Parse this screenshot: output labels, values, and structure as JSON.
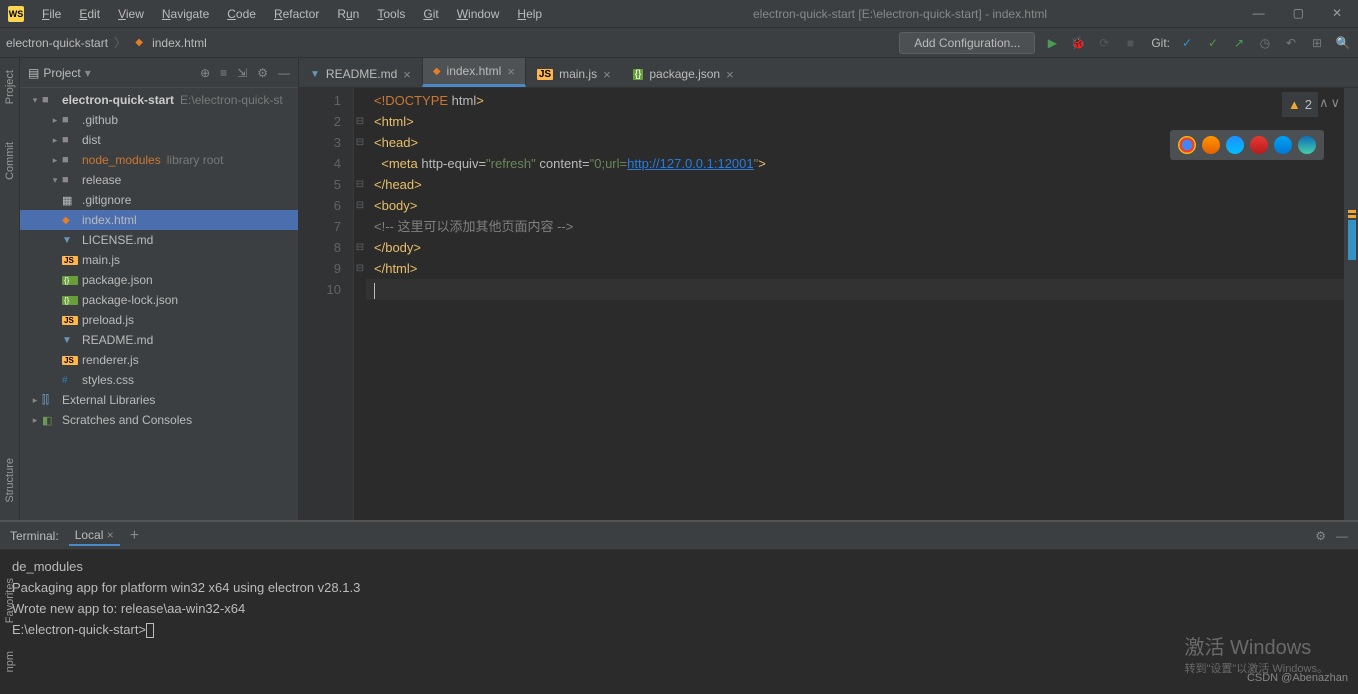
{
  "app": {
    "icon": "WS",
    "title": "electron-quick-start [E:\\electron-quick-start] - index.html"
  },
  "menu": [
    "File",
    "Edit",
    "View",
    "Navigate",
    "Code",
    "Refactor",
    "Run",
    "Tools",
    "Git",
    "Window",
    "Help"
  ],
  "breadcrumb": {
    "root": "electron-quick-start",
    "file": "index.html"
  },
  "toolbar": {
    "config": "Add Configuration...",
    "git_label": "Git:"
  },
  "project_panel": {
    "title": "Project",
    "root": {
      "name": "electron-quick-start",
      "path": "E:\\electron-quick-st"
    },
    "folders": [
      {
        "name": ".github",
        "expanded": false
      },
      {
        "name": "dist",
        "expanded": false
      },
      {
        "name": "node_modules",
        "hint": "library root",
        "expanded": false,
        "highlight": true
      },
      {
        "name": "release",
        "expanded": false
      }
    ],
    "files": [
      {
        "name": ".gitignore",
        "type": "txt"
      },
      {
        "name": "index.html",
        "type": "html",
        "selected": true
      },
      {
        "name": "LICENSE.md",
        "type": "md"
      },
      {
        "name": "main.js",
        "type": "js"
      },
      {
        "name": "package.json",
        "type": "json"
      },
      {
        "name": "package-lock.json",
        "type": "json"
      },
      {
        "name": "preload.js",
        "type": "js"
      },
      {
        "name": "README.md",
        "type": "md"
      },
      {
        "name": "renderer.js",
        "type": "js"
      },
      {
        "name": "styles.css",
        "type": "css"
      }
    ],
    "extra": [
      "External Libraries",
      "Scratches and Consoles"
    ]
  },
  "tabs": [
    {
      "label": "README.md",
      "type": "md"
    },
    {
      "label": "index.html",
      "type": "html",
      "active": true
    },
    {
      "label": "main.js",
      "type": "js"
    },
    {
      "label": "package.json",
      "type": "json"
    }
  ],
  "code": {
    "lines": [
      "1",
      "2",
      "3",
      "4",
      "5",
      "6",
      "7",
      "8",
      "9",
      "10"
    ],
    "l1_doctype": "<!DOCTYPE",
    "l1_html": " html",
    "l4_meta": "meta",
    "l4_attr1": "http-equiv=",
    "l4_val1": "\"refresh\"",
    "l4_attr2": "content=",
    "l4_val2a": "\"0;url=",
    "l4_link": "http://127.0.0.1:12001",
    "l4_val2b": "\"",
    "l7_comment": "<!-- 这里可以添加其他页面内容 -->"
  },
  "warnings": {
    "count": "2"
  },
  "terminal": {
    "label": "Terminal:",
    "tab": "Local",
    "lines": [
      "de_modules",
      "",
      "Packaging app for platform win32 x64 using electron v28.1.3",
      "Wrote new app to: release\\aa-win32-x64",
      "",
      "E:\\electron-quick-start>"
    ]
  },
  "left_gutter": [
    "Project",
    "Commit",
    "Structure"
  ],
  "bottom_gutter": [
    "Favorites",
    "npm"
  ],
  "watermark": {
    "title": "激活 Windows",
    "sub": "转到\"设置\"以激活 Windows。"
  },
  "csdn": "CSDN @Abenazhan"
}
